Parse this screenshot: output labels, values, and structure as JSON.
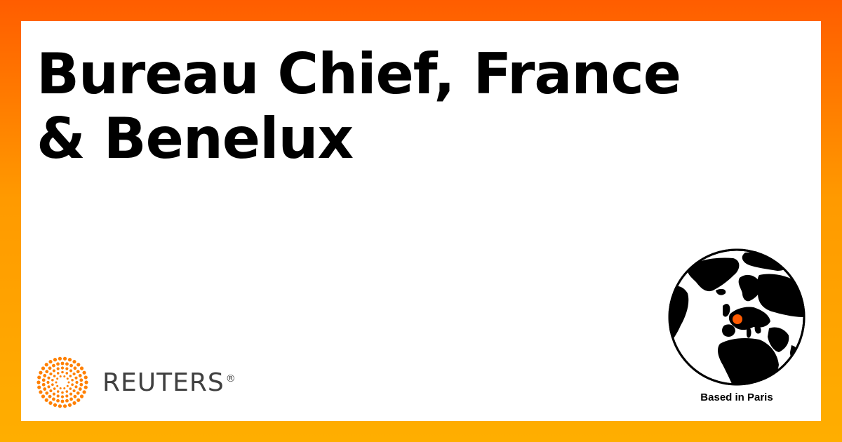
{
  "job": {
    "title": "Bureau Chief, France & Benelux",
    "location_caption": "Based in Paris"
  },
  "brand": {
    "name": "REUTERS",
    "registered_mark": "®"
  },
  "colors": {
    "accent": "#ff8000",
    "bg_top": "#ff5d00",
    "bg_bottom": "#ffae00",
    "logo_text": "#404040",
    "marker": "#ff5a00"
  },
  "icons": {
    "logo": "reuters-dot-ring-icon",
    "globe": "globe-icon",
    "marker": "location-marker-icon"
  }
}
